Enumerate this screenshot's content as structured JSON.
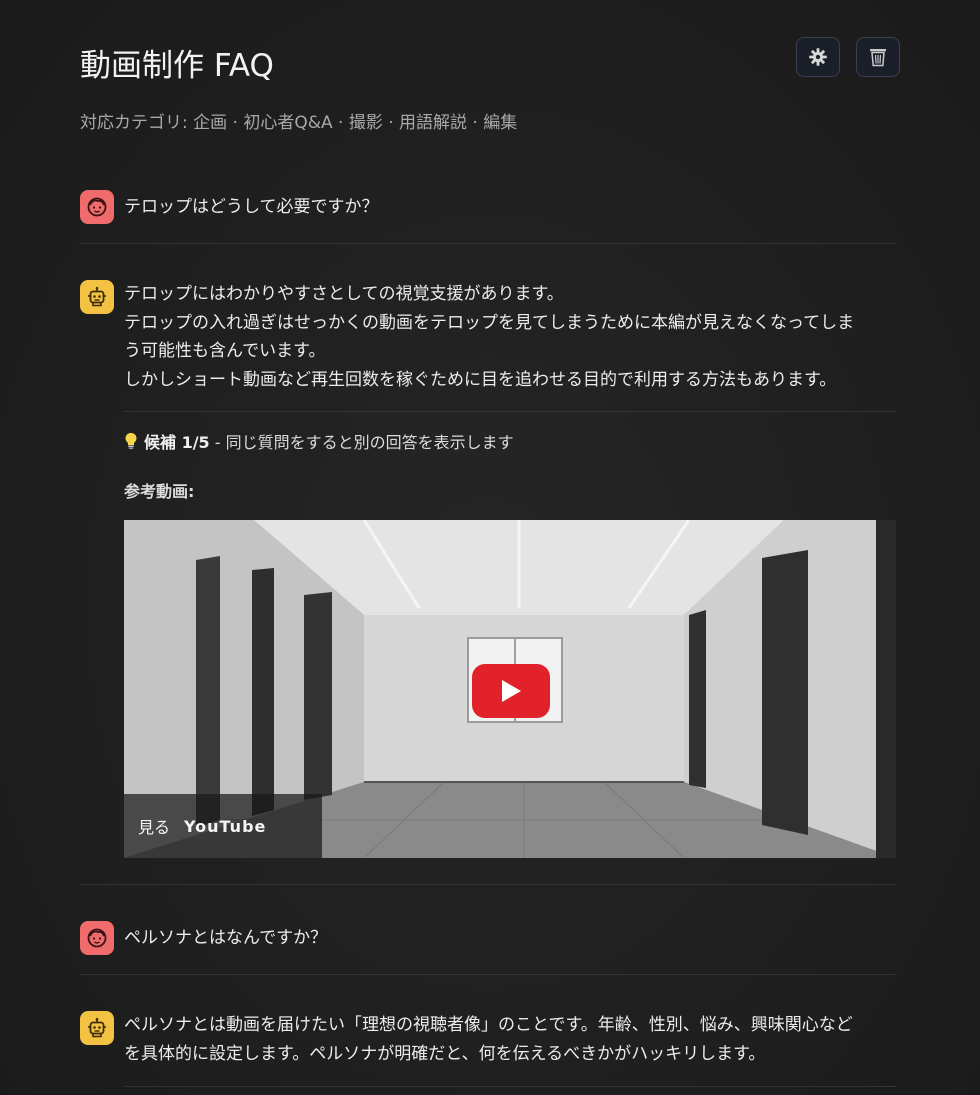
{
  "header": {
    "title": "動画制作 FAQ",
    "subtitle": "対応カテゴリ: 企画 · 初心者Q&A · 撮影 · 用語解説 · 編集",
    "settings_icon": "gear-icon",
    "trash_icon": "trash-icon"
  },
  "messages": [
    {
      "role": "user",
      "icon": "user-face-icon",
      "text": "テロップはどうして必要ですか？"
    },
    {
      "role": "bot",
      "icon": "robot-icon",
      "lines": [
        "テロップにはわかりやすさとしての視覚支援があります。",
        "テロップの入れ過ぎはせっかくの動画をテロップを見てしまうために本編が見えなくなってしま",
        "う可能性も含んでいます。",
        "しかしショート動画など再生回数を稼ぐために目を追わせる目的で利用する方法もあります。"
      ],
      "candidate": {
        "icon": "lightbulb-icon",
        "label": "候補 1/5",
        "note": " - 同じ質問をすると別の回答を表示します"
      },
      "reference_label": "参考動画:",
      "video": {
        "watch_label": "見る",
        "platform_label": "YouTube",
        "play_icon": "play-icon"
      }
    },
    {
      "role": "user",
      "icon": "user-face-icon",
      "text": "ペルソナとはなんですか？"
    },
    {
      "role": "bot",
      "icon": "robot-icon",
      "lines": [
        "ペルソナとは動画を届けたい「理想の視聴者像」のことです。年齢、性別、悩み、興味関心など",
        "を具体的に設定します。ペルソナが明確だと、何を伝えるべきかがハッキリします。"
      ]
    }
  ],
  "colors": {
    "background": "#202020",
    "user_avatar": "#f06b6b",
    "bot_avatar": "#f4c242",
    "play_button": "#e1222a"
  }
}
